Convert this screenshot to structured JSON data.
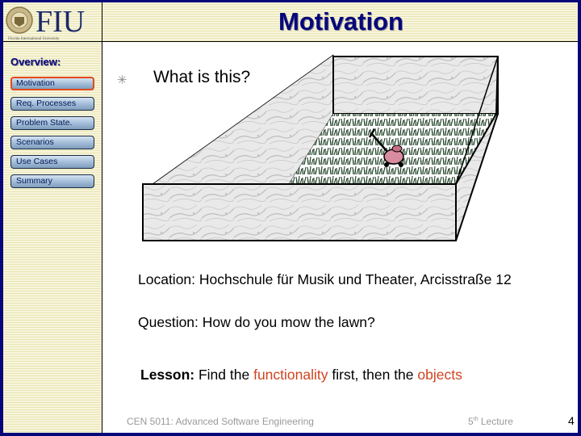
{
  "header": {
    "logo_text": "FIU",
    "logo_subtitle": "Florida International University",
    "title": "Motivation"
  },
  "sidebar": {
    "heading": "Overview:",
    "items": [
      {
        "label": "Motivation",
        "active": true
      },
      {
        "label": "Req. Processes",
        "active": false
      },
      {
        "label": "Problem State.",
        "active": false
      },
      {
        "label": "Scenarios",
        "active": false
      },
      {
        "label": "Use Cases",
        "active": false
      },
      {
        "label": "Summary",
        "active": false
      }
    ]
  },
  "content": {
    "bullet_icon": "asterisk-bullet",
    "question_title": "What is this?",
    "illustration": "marble-walled lawn with lawn mower",
    "location": "Location: Hochschule für Musik und Theater,  Arcisstraße 12",
    "question": "Question: How do you mow the lawn?",
    "lesson": {
      "label": "Lesson:",
      "part1": " Find the ",
      "highlight1": "functionality",
      "part2": " first, then the ",
      "highlight2": "objects"
    }
  },
  "footer": {
    "course": "CEN 5011: Advanced Software Engineering",
    "lecture_num": "5",
    "lecture_sup": "th",
    "lecture_label": " Lecture",
    "page": "4"
  },
  "colors": {
    "frame": "#06067a",
    "title": "#07077a",
    "accent": "#d2431f",
    "active_border": "#e04a1a"
  }
}
